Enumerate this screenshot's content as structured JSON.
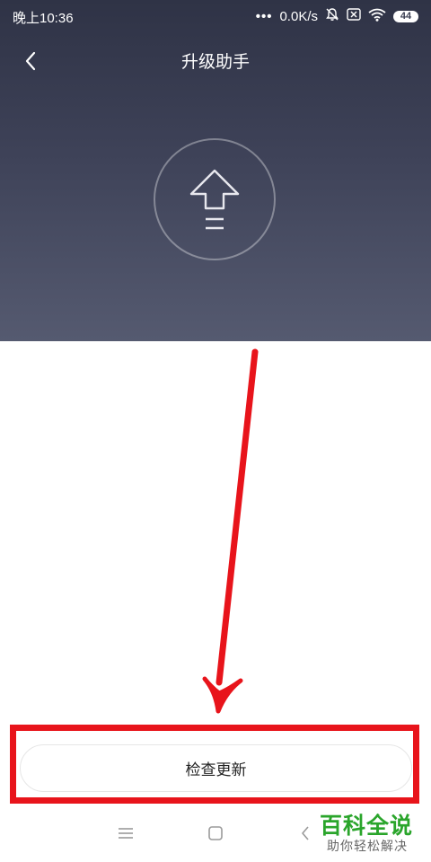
{
  "status_bar": {
    "time": "晚上10:36",
    "dots": "•••",
    "network_speed": "0.0K/s",
    "battery_level": "44",
    "icons": [
      "bell-muted-icon",
      "sim-disabled-icon",
      "wifi-icon",
      "battery-icon"
    ]
  },
  "header": {
    "title": "升级助手",
    "back_icon": "chevron-left-icon",
    "upgrade_icon": "upgrade-arrow-icon"
  },
  "main": {
    "check_update_label": "检查更新"
  },
  "annotation": {
    "arrow_color": "#e8141b",
    "highlight_color": "#e8141b"
  },
  "nav_bar": {
    "icons": [
      "menu-icon",
      "home-icon",
      "back-icon"
    ]
  },
  "watermark": {
    "title": "百科全说",
    "subtitle": "助你轻松解决"
  }
}
